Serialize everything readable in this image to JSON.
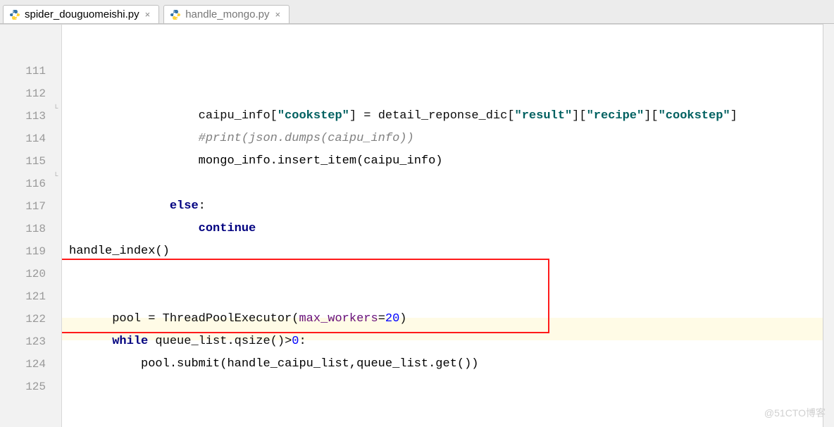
{
  "tabs": [
    {
      "label": "spider_douguomeishi.py",
      "active": true
    },
    {
      "label": "handle_mongo.py",
      "active": false
    }
  ],
  "gutter": {
    "start": 111,
    "count": 15
  },
  "code": {
    "l111": {
      "pre": "            caipu_info[",
      "s1": "\"cookstep\"",
      "mid1": "] = detail_reponse_dic[",
      "s2": "\"result\"",
      "mid2": "][",
      "s3": "\"recipe\"",
      "mid3": "][",
      "s4": "\"cookstep\"",
      "post": "]"
    },
    "l112": {
      "pre": "            ",
      "cmt": "#print(json.dumps(caipu_info))"
    },
    "l113": {
      "pre": "            ",
      "txt": "mongo_info.insert_item(caipu_info)"
    },
    "l114": {
      "txt": ""
    },
    "l115": {
      "pre": "        ",
      "kw": "else",
      "post": ":"
    },
    "l116": {
      "pre": "            ",
      "kw": "continue"
    },
    "l117": {
      "txt": ""
    },
    "l118": {
      "txt": ""
    },
    "l119": {
      "txt": "handle_index()"
    },
    "l120": {
      "p0": "pool = ThreadPoolExecutor(",
      "nm": "max_workers",
      "eq": "=",
      "num": "20",
      "p1": ")"
    },
    "l121": {
      "kw": "while",
      "mid": " queue_list.qsize()>",
      "num": "0",
      "post": ":"
    },
    "l122": {
      "pre": "    ",
      "txt": "pool.submit(handle_caipu_list,queue_list.get())"
    },
    "l123": {
      "txt": ""
    },
    "l124": {
      "txt": ""
    },
    "l125": {
      "txt": ""
    }
  },
  "watermark": "@51CTO博客"
}
